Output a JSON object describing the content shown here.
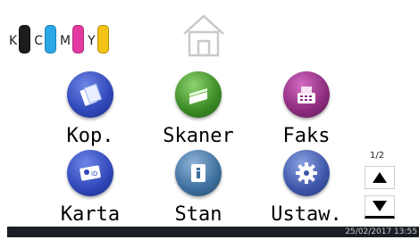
{
  "ink": {
    "k": {
      "letter": "K",
      "color": "#1c1c1c"
    },
    "c": {
      "letter": "C",
      "color": "#29a8e8"
    },
    "m": {
      "letter": "M",
      "color": "#e23aa1"
    },
    "y": {
      "letter": "Y",
      "color": "#f3c316"
    }
  },
  "apps": [
    {
      "label": "Kop.",
      "icon": "copy-icon",
      "color": "#2f47b8"
    },
    {
      "label": "Skaner",
      "icon": "scanner-icon",
      "color": "#3a8a24"
    },
    {
      "label": "Faks",
      "icon": "fax-icon",
      "color": "#8c2a7c"
    },
    {
      "label": "Karta",
      "icon": "id-card-icon",
      "color": "#2f47b8"
    },
    {
      "label": "Stan",
      "icon": "status-icon",
      "color": "#3d6f9d"
    },
    {
      "label": "Ustaw.",
      "icon": "settings-icon",
      "color": "#3d55a8"
    }
  ],
  "pager": {
    "indicator": "1/2"
  },
  "status": {
    "datetime": "25/02/2017 13:55"
  }
}
